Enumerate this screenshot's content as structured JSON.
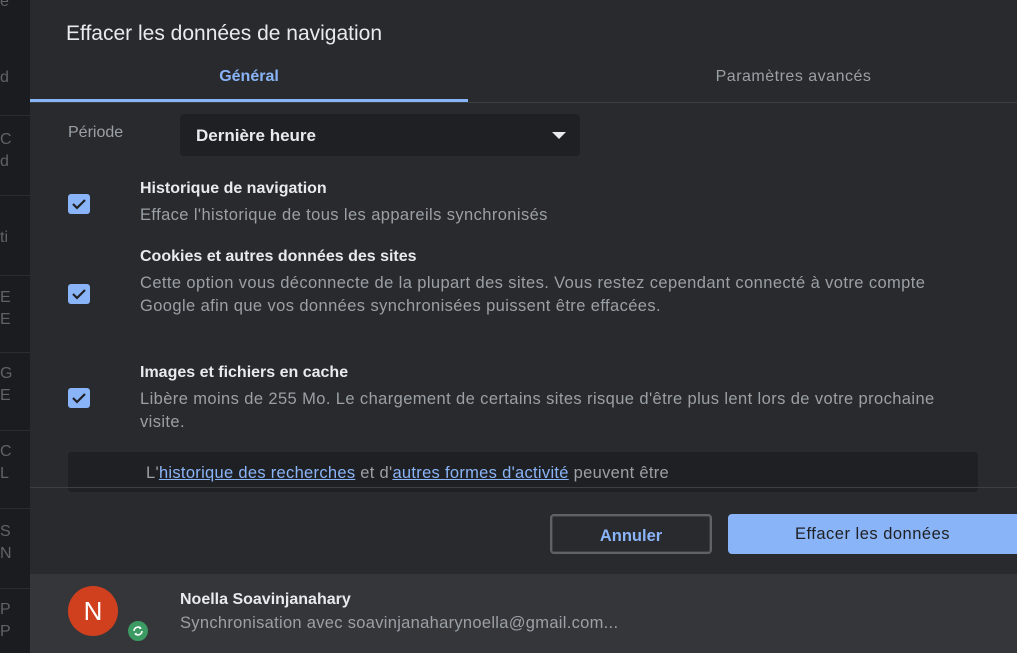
{
  "background": {
    "fragments": [
      "e",
      "d",
      "C",
      "d",
      "ti",
      "E",
      "E",
      "G",
      "E",
      "C",
      "L",
      "S",
      "N",
      "P",
      "P"
    ]
  },
  "dialog": {
    "title": "Effacer les données de navigation",
    "tabs": [
      {
        "label": "Général",
        "selected": true
      },
      {
        "label": "Paramètres avancés",
        "selected": false
      }
    ],
    "period": {
      "label": "Période",
      "value": "Dernière heure"
    },
    "options": [
      {
        "title": "Historique de navigation",
        "desc": "Efface l'historique de tous les appareils synchronisés",
        "checked": true
      },
      {
        "title": "Cookies et autres données des sites",
        "desc": "Cette option vous déconnecte de la plupart des sites. Vous restez cependant connecté à votre compte Google afin que vos données synchronisées puissent être effacées.",
        "checked": true
      },
      {
        "title": "Images et fichiers en cache",
        "desc": "Libère moins de 255 Mo. Le chargement de certains sites risque d'être plus lent lors de votre prochaine visite.",
        "checked": true
      }
    ],
    "notice": {
      "prefix": "L'",
      "link1": "historique des recherches",
      "middle": " et d'",
      "link2": "autres formes d'activité",
      "suffix": " peuvent être"
    },
    "buttons": {
      "cancel": "Annuler",
      "clear": "Effacer les données"
    }
  },
  "account": {
    "initial": "N",
    "name": "Noella Soavinjanahary",
    "sync": "Synchronisation avec soavinjanaharynoella@gmail.com..."
  },
  "colors": {
    "accent": "#8ab4f8",
    "dialog_bg": "#292a2d",
    "avatar": "#d0401f",
    "sync_badge": "#3c9a63"
  }
}
